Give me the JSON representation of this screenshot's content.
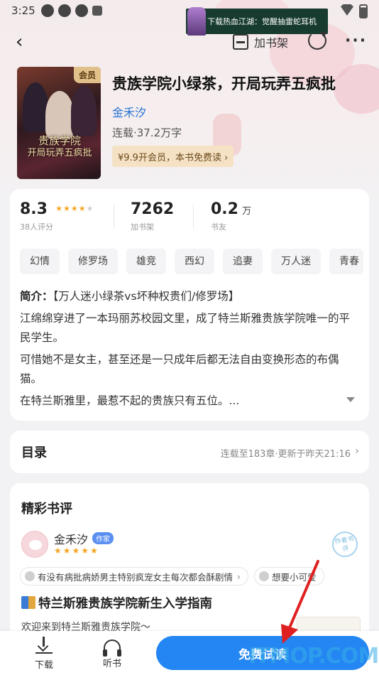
{
  "status_bar": {
    "time": "3:25"
  },
  "ad": {
    "text": "下载热血江湖：觉醒抽雷蛇耳机"
  },
  "nav": {
    "back_icon": "chevron-left-icon",
    "shelf_label": "加书架"
  },
  "book": {
    "cover_badge": "会员",
    "cover_title_line1": "贵族学院",
    "cover_title_line2": "开局玩弄五疯批",
    "title": "贵族学院小绿茶，开局玩弄五疯批",
    "author": "金禾汐",
    "status": "连载·37.2万字",
    "vip_promo": "¥9.9开会员，本书免费读 ›"
  },
  "stats": {
    "rating": {
      "value": "8.3",
      "label": "38人评分",
      "stars": 4
    },
    "shelf": {
      "value": "7262",
      "label": "加书架"
    },
    "fans": {
      "value": "0.2",
      "unit": "万",
      "label": "书友"
    }
  },
  "tags": [
    "幻情",
    "修罗场",
    "雄竞",
    "西幻",
    "追妻",
    "万人迷",
    "青春"
  ],
  "synopsis": {
    "label": "简介：",
    "intro": "【万人迷小绿茶vs坏种权贵们/修罗场】",
    "p1": "江绵绵穿进了一本玛丽苏校园文里，成了特兰斯雅贵族学院唯一的平民学生。",
    "p2": "可惜她不是女主，甚至还是一只成年后都无法自由变换形态的布偶猫。",
    "p3": "在特兰斯雅里，最惹不起的贵族只有五位。..."
  },
  "toc": {
    "title": "目录",
    "status": "连载至183章·更新于昨天21:16"
  },
  "reviews": {
    "heading": "精彩书评",
    "reviewer": "金禾汐",
    "author_badge": "作家",
    "stamp": "作者书评",
    "topics": [
      "有没有病批病娇男主特别疯宠女主每次都会酥剧情",
      "想要小可爱"
    ],
    "post_title": "特兰斯雅贵族学院新生入学指南",
    "post_excerpt": "欢迎来到特兰斯雅贵族学院～"
  },
  "bottom": {
    "download_label": "下载",
    "listen_label": "听书",
    "read_label": "免费试读"
  },
  "watermark": "ITMOP.COM",
  "colors": {
    "accent": "#2486f3",
    "author_link": "#2a74d6",
    "star": "#f5a623",
    "vip_bg": "#f5e2c4"
  }
}
